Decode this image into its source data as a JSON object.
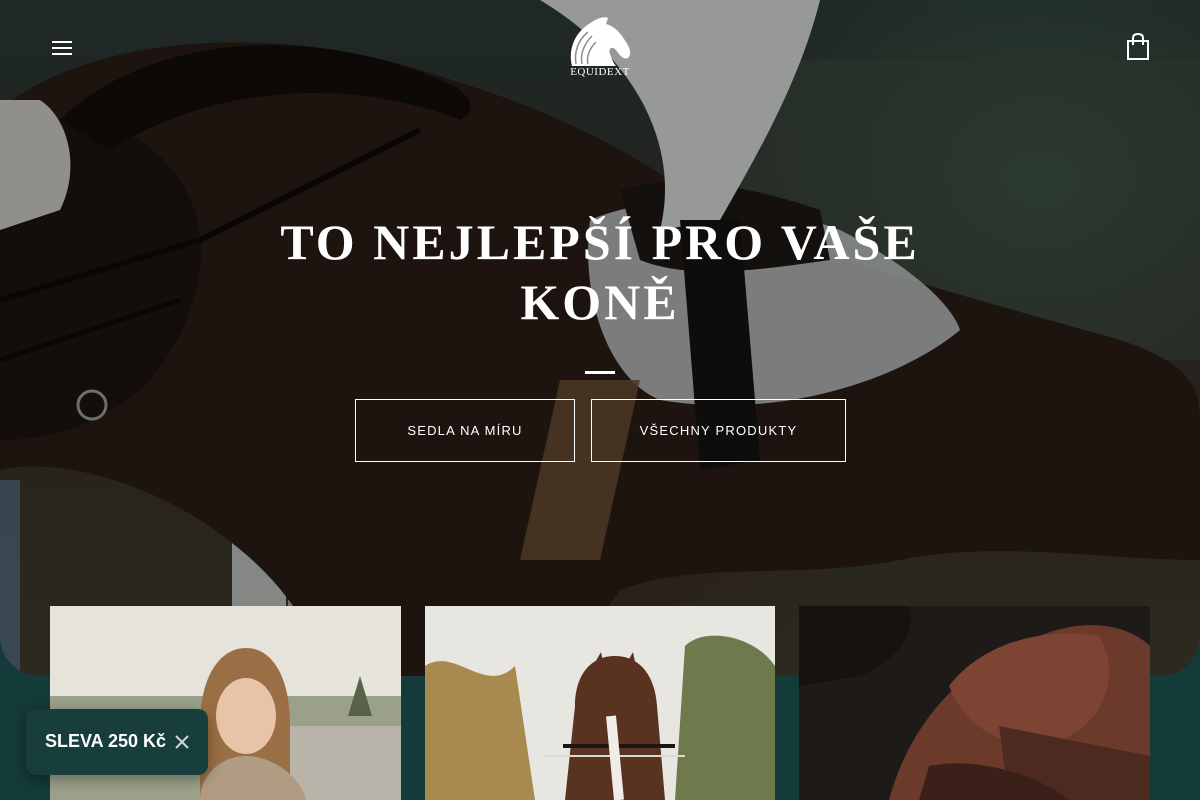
{
  "header": {
    "menu_icon": "hamburger-menu-icon",
    "logo_text": "EQUIDEXT",
    "cart_icon": "shopping-bag-icon"
  },
  "hero": {
    "title": "TO NEJLEPŠÍ PRO VAŠE KONĚ",
    "buttons": [
      {
        "label": "SEDLA NA MÍRU"
      },
      {
        "label": "VŠECHNY PRODUKTY"
      }
    ]
  },
  "promo": {
    "label": "SLEVA 250 Kč",
    "close_icon": "close-icon"
  },
  "colors": {
    "promo_bg": "#173e3c",
    "page_bg": "#143a3a",
    "text": "#ffffff"
  }
}
